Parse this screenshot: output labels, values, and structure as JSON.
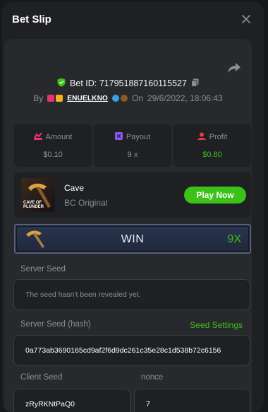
{
  "header": {
    "title": "Bet Slip"
  },
  "bet": {
    "id_label": "Bet ID: 717951887160115527",
    "by_label": "By",
    "username": "ENUELKNO",
    "on_label": "On",
    "timestamp": "29/6/2022, 18:06:43"
  },
  "stats": {
    "amount": {
      "label": "Amount",
      "value": "$0.10"
    },
    "payout": {
      "label": "Payout",
      "value": "9 x"
    },
    "profit": {
      "label": "Profit",
      "value": "$0.80"
    }
  },
  "game": {
    "name": "Cave",
    "provider": "BC Original",
    "thumb_caption": "CAVE OF PLUNDER",
    "play_label": "Play Now"
  },
  "result": {
    "label": "WIN",
    "multiplier": "9X"
  },
  "seeds": {
    "server_seed_label": "Server Seed",
    "server_seed_placeholder": "The seed hasn't been revealed yet.",
    "hash_label": "Server Seed (hash)",
    "settings_label": "Seed Settings",
    "hash_value": "0a773ab3690165cd9af2f6d9dc261c35e28c1d538b72c6156",
    "client_seed_label": "Client Seed",
    "nonce_label": "nonce",
    "client_seed_value": "zRyRKNtPaQ0",
    "nonce_value": "7"
  },
  "colors": {
    "accent": "#3bc117",
    "amount_icon": "#e5356e",
    "payout_icon": "#8a5bf7",
    "profit_icon": "#e53d3d"
  }
}
